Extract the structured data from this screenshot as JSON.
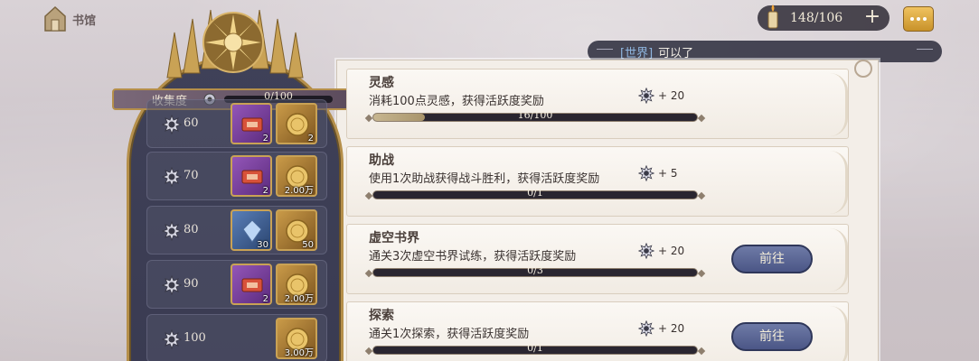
{
  "top_bar": {
    "home_label": "书馆",
    "currency_value": "148/106",
    "currency_plus": "+"
  },
  "world_chat": {
    "channel": "[世界]",
    "message": "可以了"
  },
  "collection": {
    "label": "收集度",
    "progress_text": "0/100",
    "progress": 0
  },
  "tiers": [
    {
      "level": "60",
      "items": [
        {
          "type": "purple",
          "count": "2"
        },
        {
          "type": "gold",
          "count": "2"
        }
      ]
    },
    {
      "level": "70",
      "items": [
        {
          "type": "purple",
          "count": "2"
        },
        {
          "type": "gold",
          "count": "2.00万"
        }
      ]
    },
    {
      "level": "80",
      "items": [
        {
          "type": "blue",
          "count": "30"
        },
        {
          "type": "gold",
          "count": "50"
        }
      ]
    },
    {
      "level": "90",
      "items": [
        {
          "type": "purple",
          "count": "2"
        },
        {
          "type": "gold",
          "count": "2.00万"
        }
      ]
    },
    {
      "level": "100",
      "items": [
        {
          "type": "gold",
          "count": "3.00万"
        }
      ]
    }
  ],
  "quests": [
    {
      "title": "灵感",
      "desc": "消耗100点灵感，获得活跃度奖励",
      "progress_text": "16/100",
      "progress": 0.16,
      "reward": "+ 20",
      "button": ""
    },
    {
      "title": "助战",
      "desc": "使用1次助战获得战斗胜利，获得活跃度奖励",
      "progress_text": "0/1",
      "progress": 0,
      "reward": "+ 5",
      "button": ""
    },
    {
      "title": "虚空书界",
      "desc": "通关3次虚空书界试练，获得活跃度奖励",
      "progress_text": "0/3",
      "progress": 0,
      "reward": "+ 20",
      "button": "前往"
    },
    {
      "title": "探索",
      "desc": "通关1次探索，获得活跃度奖励",
      "progress_text": "0/1",
      "progress": 0,
      "reward": "+ 20",
      "button": "前往"
    }
  ],
  "colors": {
    "accent_gold": "#b58f4a",
    "track_bg": "#3f4158",
    "button_blue": "#5a6694"
  }
}
